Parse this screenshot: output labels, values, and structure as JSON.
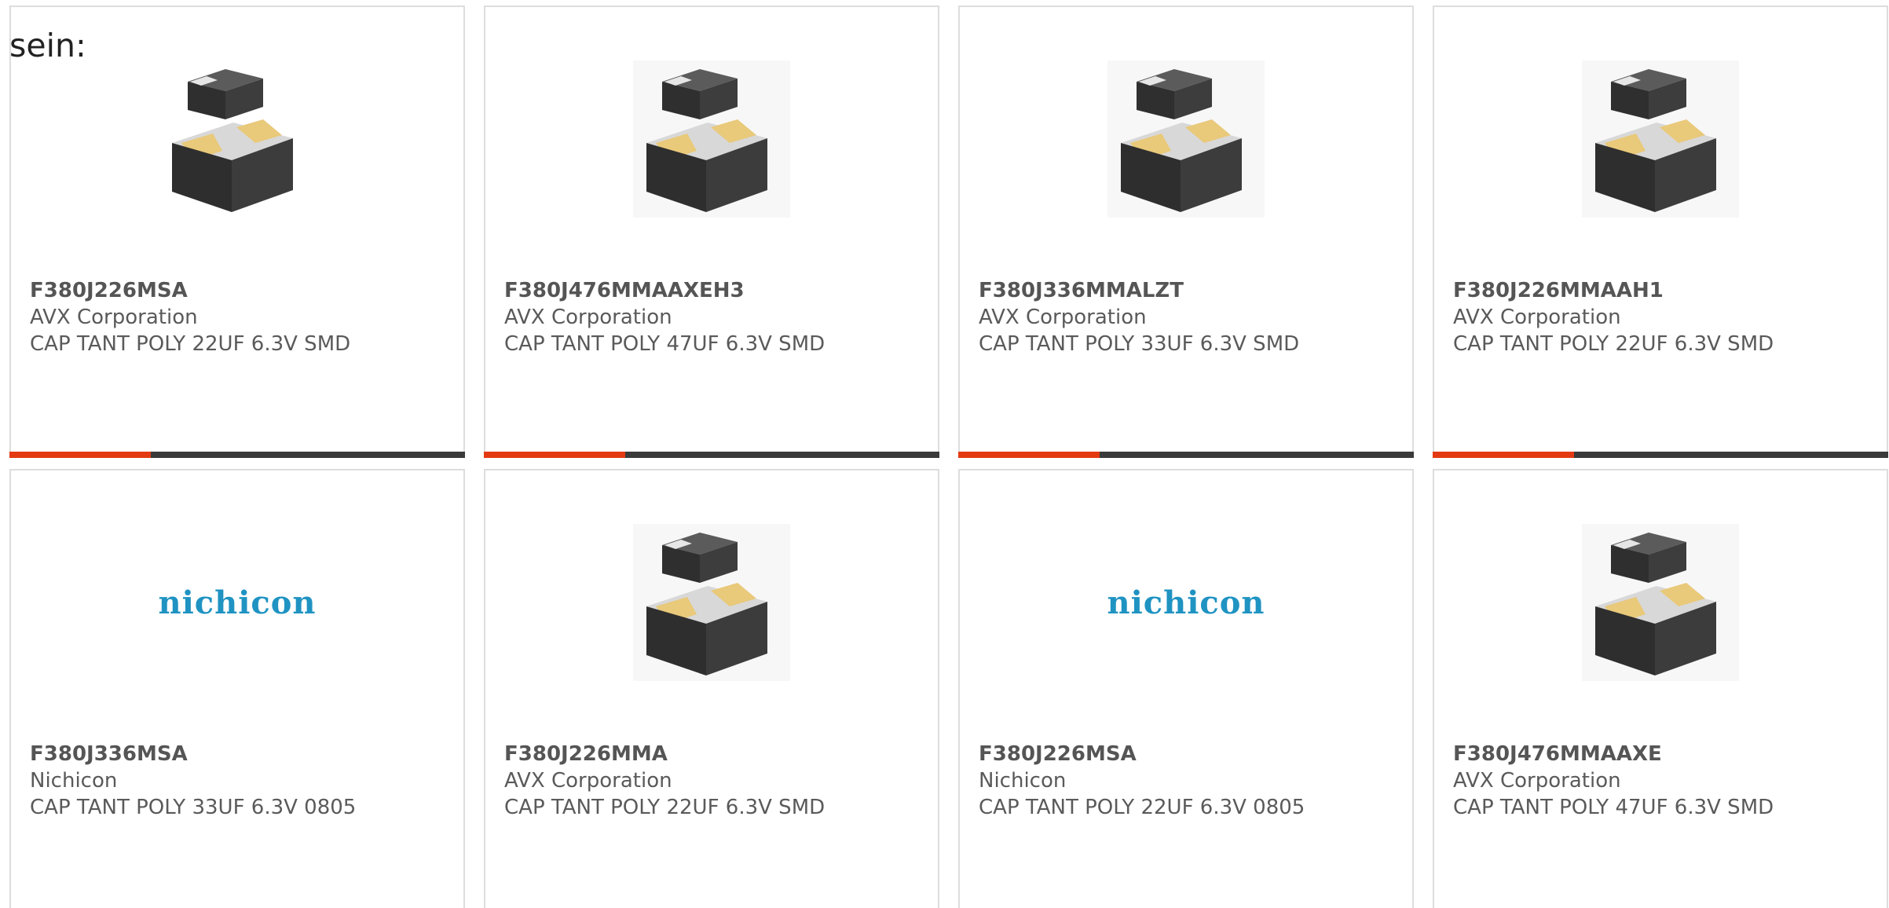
{
  "intro_text": "sein:",
  "colors": {
    "accent_bar": "#e43a12",
    "dark_bar": "#3a3a3a",
    "brand_nichicon": "#1f93c2"
  },
  "products": [
    {
      "part": "F380J226MSA",
      "manufacturer": "AVX Corporation",
      "description": "CAP TANT POLY 22UF 6.3V SMD",
      "image": "capacitor-chip-image",
      "progress": 0.31
    },
    {
      "part": "F380J476MMAAXEH3",
      "manufacturer": "AVX Corporation",
      "description": "CAP TANT POLY 47UF 6.3V SMD",
      "image": "capacitor-chip-image",
      "progress": 0.31
    },
    {
      "part": "F380J336MMALZT",
      "manufacturer": "AVX Corporation",
      "description": "CAP TANT POLY 33UF 6.3V SMD",
      "image": "capacitor-chip-image",
      "progress": 0.31
    },
    {
      "part": "F380J226MMAAH1",
      "manufacturer": "AVX Corporation",
      "description": "CAP TANT POLY 22UF 6.3V SMD",
      "image": "capacitor-chip-image",
      "progress": 0.31
    },
    {
      "part": "F380J336MSA",
      "manufacturer": "Nichicon",
      "description": "CAP TANT POLY 33UF 6.3V 0805",
      "image": "nichicon-logo",
      "logo_text": "nichicon"
    },
    {
      "part": "F380J226MMA",
      "manufacturer": "AVX Corporation",
      "description": "CAP TANT POLY 22UF 6.3V SMD",
      "image": "capacitor-chip-image"
    },
    {
      "part": "F380J226MSA",
      "manufacturer": "Nichicon",
      "description": "CAP TANT POLY 22UF 6.3V 0805",
      "image": "nichicon-logo",
      "logo_text": "nichicon"
    },
    {
      "part": "F380J476MMAAXE",
      "manufacturer": "AVX Corporation",
      "description": "CAP TANT POLY 47UF 6.3V SMD",
      "image": "capacitor-chip-image"
    }
  ]
}
